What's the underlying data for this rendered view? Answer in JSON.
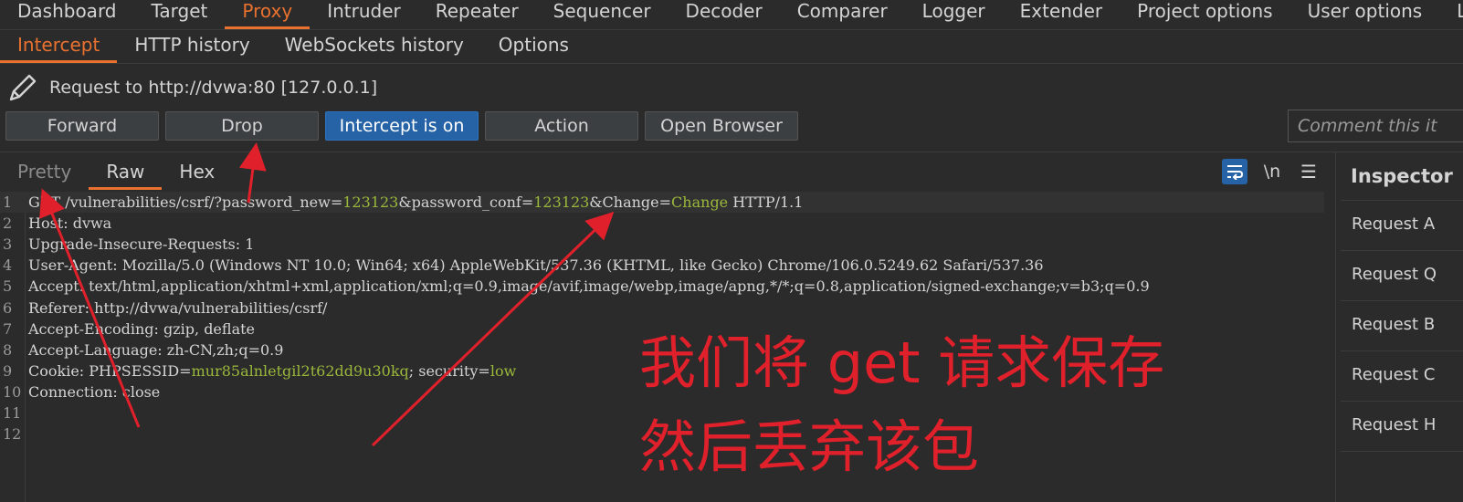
{
  "top_tabs": [
    "Dashboard",
    "Target",
    "Proxy",
    "Intruder",
    "Repeater",
    "Sequencer",
    "Decoder",
    "Comparer",
    "Logger",
    "Extender",
    "Project options",
    "User options",
    "Lea"
  ],
  "top_active": "Proxy",
  "sub_tabs": [
    "Intercept",
    "HTTP history",
    "WebSockets history",
    "Options"
  ],
  "sub_active": "Intercept",
  "request_line": {
    "icon": "pencil-icon",
    "text": "Request to http://dvwa:80  [127.0.0.1]"
  },
  "buttons": {
    "forward": "Forward",
    "drop": "Drop",
    "intercept": "Intercept is on",
    "action": "Action",
    "open_browser": "Open Browser"
  },
  "comment_placeholder": "Comment this it",
  "editor_tabs": [
    "Pretty",
    "Raw",
    "Hex"
  ],
  "editor_active": "Raw",
  "editor_icons": {
    "wrap": "wrap-lines-icon",
    "newline": "\\n",
    "menu": "hamburger-menu-icon"
  },
  "lines": [
    {
      "n": "1",
      "parts": [
        [
          "GET /vulnerabilities/csrf/?password_new=",
          ""
        ],
        [
          "123123",
          "v"
        ],
        [
          "&password_conf=",
          ""
        ],
        [
          "123123",
          "v"
        ],
        [
          "&Change=",
          ""
        ],
        [
          "Change",
          "v"
        ],
        [
          " HTTP/1.1",
          ""
        ]
      ]
    },
    {
      "n": "2",
      "parts": [
        [
          "Host: dvwa",
          ""
        ]
      ]
    },
    {
      "n": "3",
      "parts": [
        [
          "Upgrade-Insecure-Requests: 1",
          ""
        ]
      ]
    },
    {
      "n": "4",
      "parts": [
        [
          "User-Agent: Mozilla/5.0 (Windows NT 10.0; Win64; x64) AppleWebKit/537.36 (KHTML, like Gecko) Chrome/106.0.5249.62 Safari/537.36",
          ""
        ]
      ]
    },
    {
      "n": "5",
      "parts": [
        [
          "Accept: text/html,application/xhtml+xml,application/xml;q=0.9,image/avif,image/webp,image/apng,*/*;q=0.8,application/signed-exchange;v=b3;q=0.9",
          ""
        ]
      ]
    },
    {
      "n": "6",
      "parts": [
        [
          "Referer: http://dvwa/vulnerabilities/csrf/",
          ""
        ]
      ]
    },
    {
      "n": "7",
      "parts": [
        [
          "Accept-Encoding: gzip, deflate",
          ""
        ]
      ]
    },
    {
      "n": "8",
      "parts": [
        [
          "Accept-Language: zh-CN,zh;q=0.9",
          ""
        ]
      ]
    },
    {
      "n": "9",
      "parts": [
        [
          "Cookie: PHPSESSID=",
          ""
        ],
        [
          "mur85alnletgil2t62dd9u30kq",
          "v"
        ],
        [
          "; security=",
          ""
        ],
        [
          "low",
          "v"
        ]
      ]
    },
    {
      "n": "10",
      "parts": [
        [
          "Connection: close",
          ""
        ]
      ]
    },
    {
      "n": "11",
      "parts": []
    },
    {
      "n": "12",
      "parts": []
    }
  ],
  "inspector": {
    "title": "Inspector",
    "items": [
      "Request A",
      "Request Q",
      "Request B",
      "Request C",
      "Request H"
    ]
  },
  "annotation": {
    "line1": "我们将 get 请求保存",
    "line2": "然后丢弃该包"
  },
  "colors": {
    "accent": "#e8712f",
    "primary_button": "#2563a6",
    "value_green": "#9ab83b",
    "annotation_red": "#e0202a"
  }
}
